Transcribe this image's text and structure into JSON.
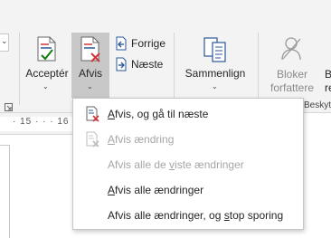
{
  "ribbon": {
    "accept": {
      "label": "Acceptér"
    },
    "reject": {
      "label": "Afvis"
    },
    "previous": {
      "label": "Forrige"
    },
    "next": {
      "label": "Næste"
    },
    "compare": {
      "label": "Sammenlign"
    },
    "block_authors": {
      "line1": "Bloker",
      "line2": "forfattere"
    },
    "cut_off": {
      "top": "B",
      "bottom": "re"
    },
    "group_label_cut": "Beskyt"
  },
  "ruler": {
    "text": "· 15 · · · 16 · ·"
  },
  "reject_menu": {
    "items": [
      {
        "before": "",
        "accel": "A",
        "after": "fvis, og gå til næste",
        "enabled": true
      },
      {
        "before": "",
        "accel": "A",
        "after": "fvis ændring",
        "enabled": false
      },
      {
        "before": "Afvis alle de ",
        "accel": "v",
        "after": "iste ændringer",
        "enabled": false
      },
      {
        "before": "",
        "accel": "A",
        "after": "fvis alle ændringer",
        "enabled": true
      },
      {
        "before": "Afvis alle ændringer, og ",
        "accel": "s",
        "after": "top sporing",
        "enabled": true
      }
    ]
  },
  "colors": {
    "ribbon_bg": "#f3f3f3",
    "hover_bg": "#c8c8c8",
    "icon_blue": "#2b579a",
    "icon_red": "#d13438",
    "icon_green": "#107c10",
    "disabled_text": "#a6a6a6"
  },
  "icons": {
    "accept": "accept-change-icon",
    "reject": "reject-change-icon",
    "previous": "previous-change-icon",
    "next": "next-change-icon",
    "compare": "compare-documents-icon",
    "block_authors": "block-authors-icon"
  }
}
